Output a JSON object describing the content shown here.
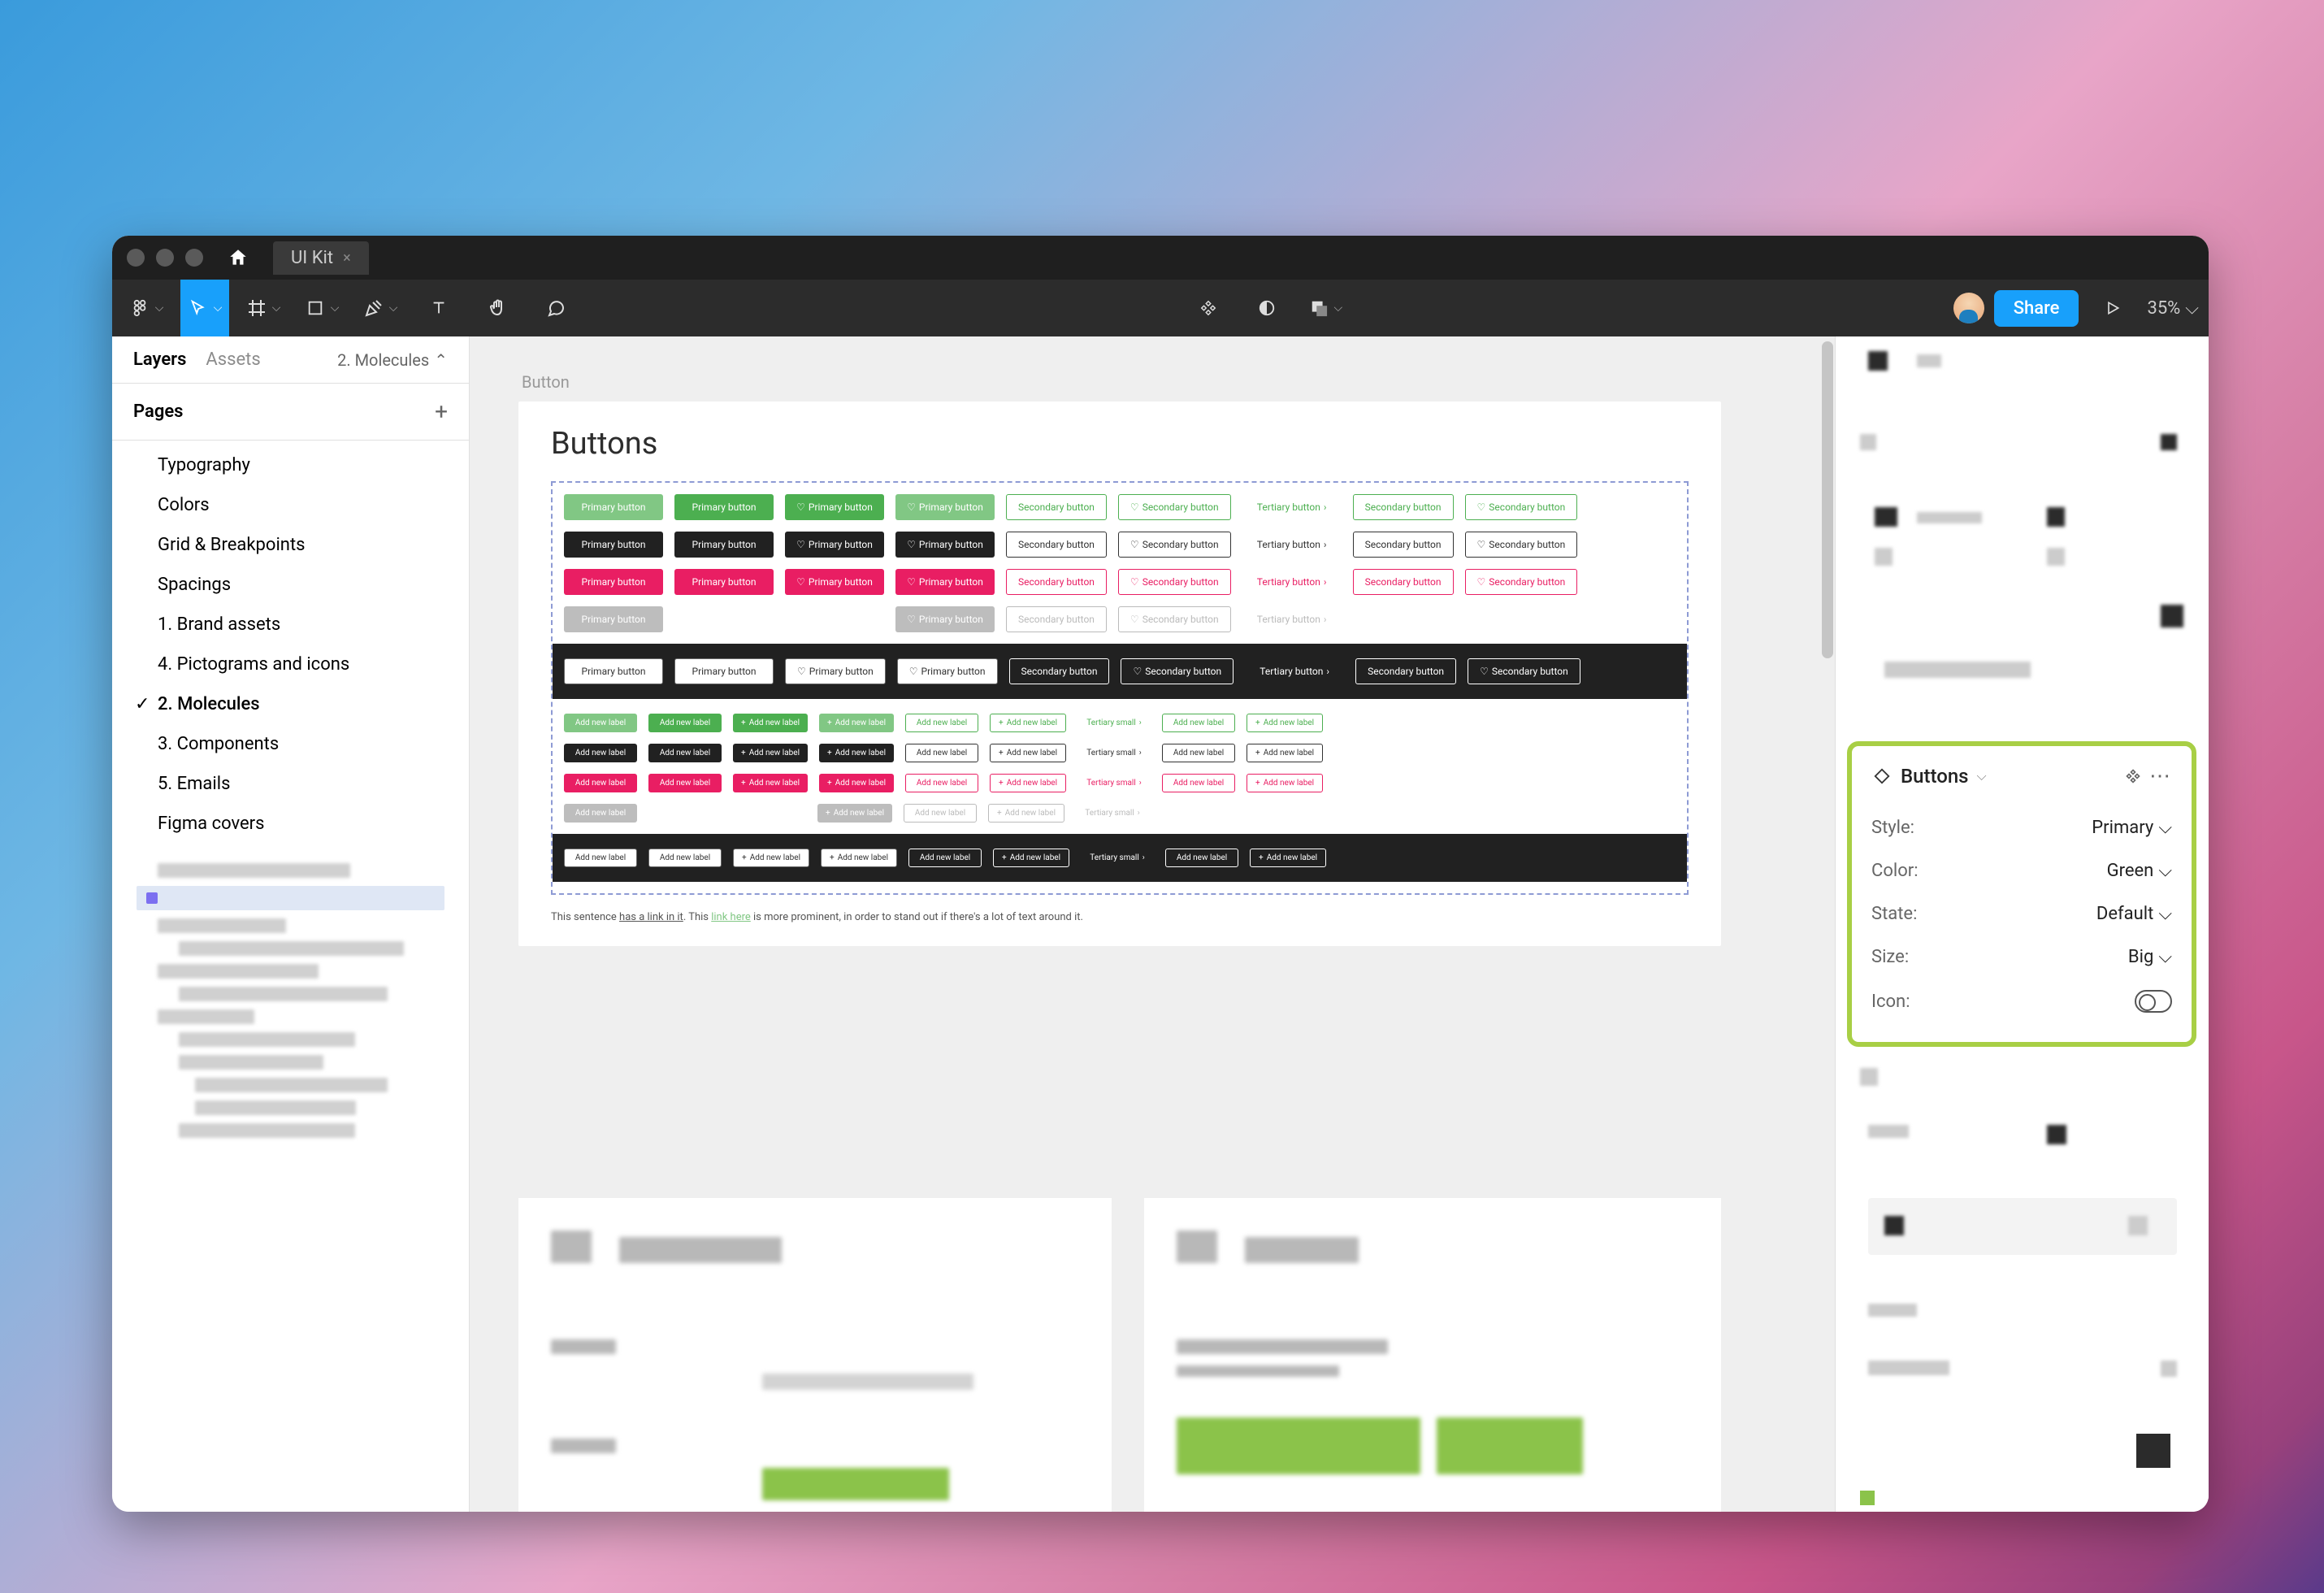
{
  "window": {
    "tabTitle": "UI Kit"
  },
  "toolbar": {
    "shareLabel": "Share",
    "zoom": "35%"
  },
  "sidebar": {
    "tabs": {
      "layers": "Layers",
      "assets": "Assets"
    },
    "pageSelector": "2. Molecules",
    "pagesHeader": "Pages",
    "pages": [
      "Typography",
      "Colors",
      "Grid & Breakpoints",
      "Spacings",
      "1. Brand assets",
      "4. Pictograms and icons",
      "2. Molecules",
      "3. Components",
      "5. Emails",
      "Figma covers"
    ],
    "selectedIndex": 6
  },
  "canvas": {
    "frameLabel": "Button",
    "heading": "Buttons",
    "labels": {
      "primary": "Primary button",
      "secondary": "Secondary button",
      "tertiary": "Tertiary button",
      "tertiarySmall": "Tertiary small",
      "addNew": "Add new label"
    },
    "linkSentence": {
      "p1": "This sentence ",
      "u1": "has a link in it",
      "p2": ". This ",
      "u2": "link here",
      "p3": " is more prominent, in order to stand out if there's a lot of text around it."
    }
  },
  "variantPanel": {
    "title": "Buttons",
    "props": {
      "style": {
        "label": "Style:",
        "value": "Primary"
      },
      "color": {
        "label": "Color:",
        "value": "Green"
      },
      "state": {
        "label": "State:",
        "value": "Default"
      },
      "size": {
        "label": "Size:",
        "value": "Big"
      },
      "icon": {
        "label": "Icon:"
      }
    }
  }
}
